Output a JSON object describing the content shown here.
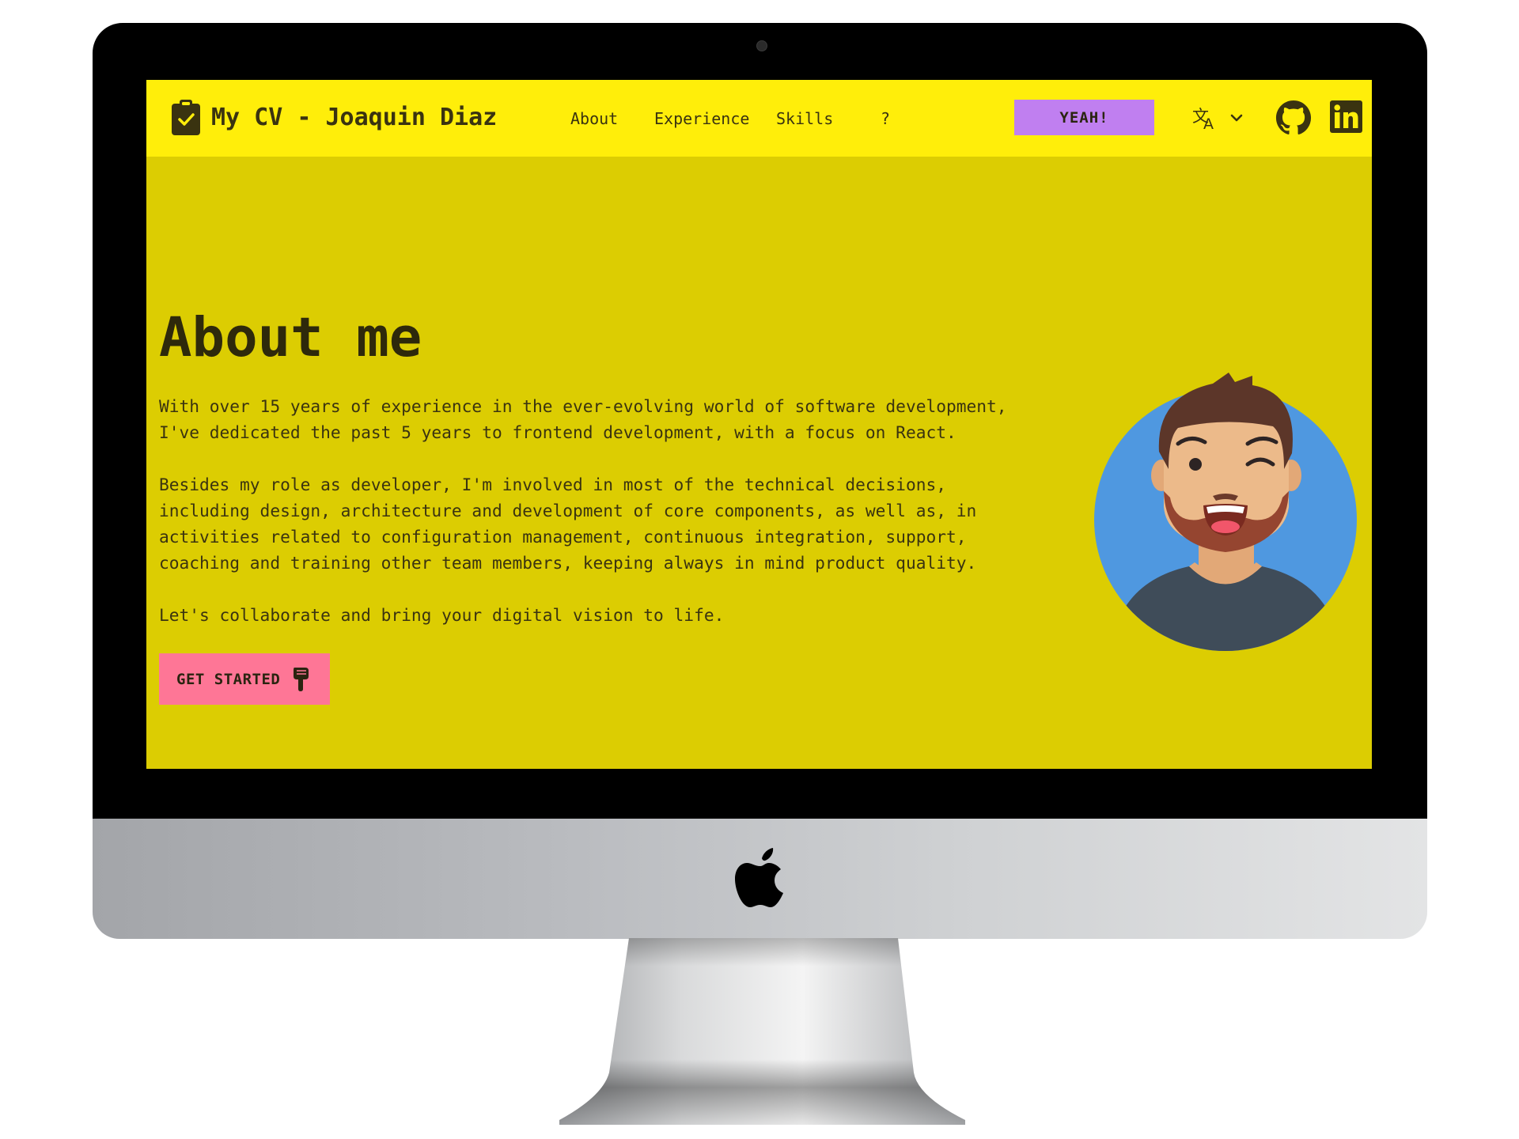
{
  "navbar": {
    "brand": "My CV - Joaquin Diaz",
    "links": [
      {
        "label": "About"
      },
      {
        "label": "Experience"
      },
      {
        "label": "Skills"
      },
      {
        "label": "?"
      }
    ],
    "cta_label": "YEAH!",
    "language_icon": "translate-icon",
    "social_icons": [
      "github-icon",
      "linkedin-icon"
    ]
  },
  "about": {
    "title": "About me",
    "paragraphs": [
      {
        "lines": [
          "With over 15 years of experience in the ever-evolving world of software development,",
          "I've dedicated the past 5 years to frontend development, with a focus on React."
        ]
      },
      {
        "lines": [
          "Besides my role as developer, I'm involved in most of the technical decisions,",
          "including design, architecture and development of core components, as well as, in",
          "activities related to configuration management, continuous integration, support,",
          "coaching and training other team members, keeping always in mind product quality."
        ]
      },
      {
        "lines": [
          "Let's collaborate and bring your digital vision to life."
        ]
      }
    ],
    "button_label": "GET STARTED",
    "button_icon": "pointing-down-hand-icon"
  },
  "colors": {
    "navbar_bg": "#ffee0a",
    "hero_bg": "#dccd02",
    "cta_purple": "#c07ff0",
    "button_pink": "#fe7696",
    "text_dark": "#3a3310"
  }
}
